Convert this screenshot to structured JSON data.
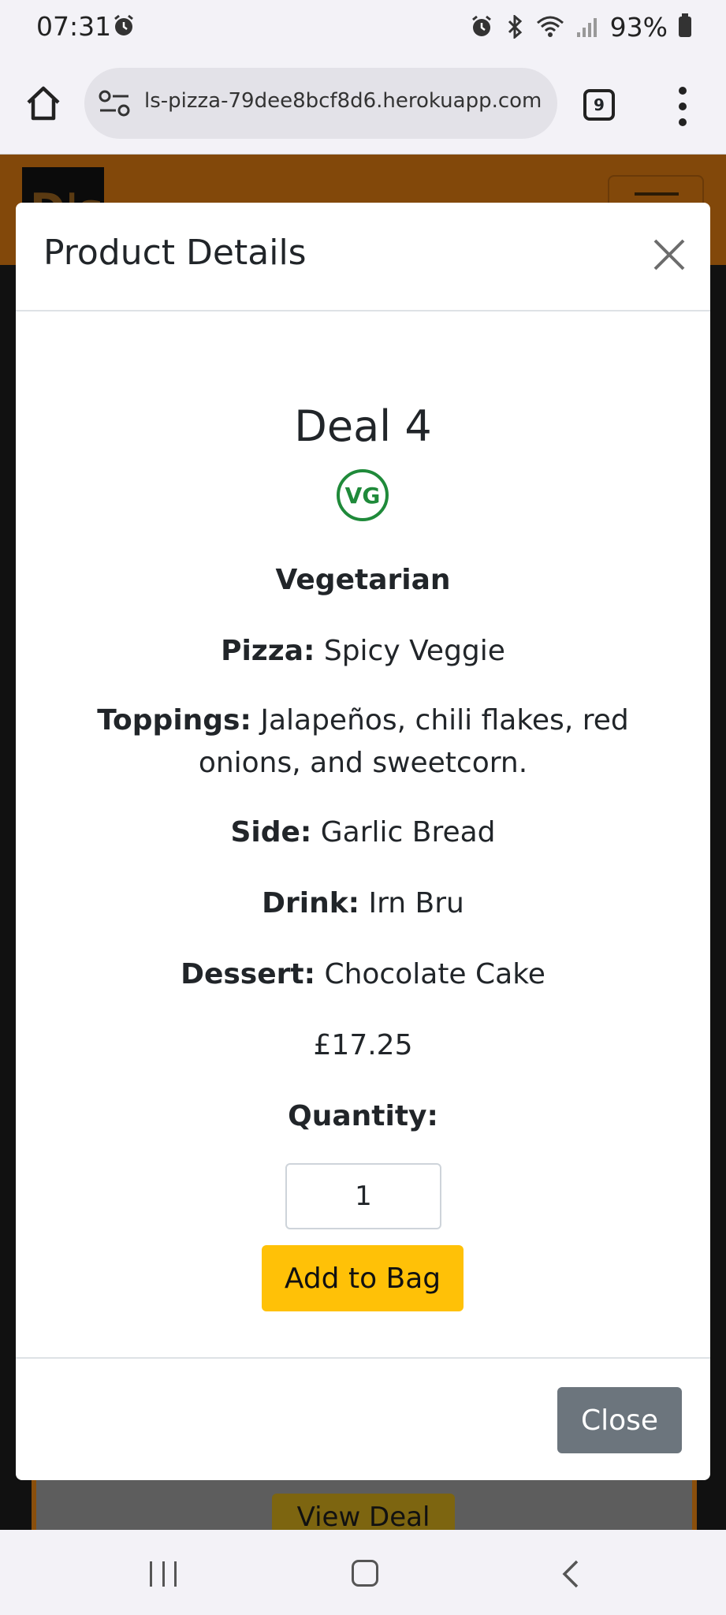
{
  "status_bar": {
    "time": "07:31",
    "battery": "93%"
  },
  "browser": {
    "url": "ls-pizza-79dee8bcf8d6.herokuapp.com",
    "tab_count": "9"
  },
  "page": {
    "logo_text": "D's",
    "view_deal_label": "View Deal",
    "header_color": "#82480a"
  },
  "modal": {
    "title": "Product Details",
    "deal_name": "Deal 4",
    "diet_badge": "VG",
    "diet_label": "Vegetarian",
    "pizza_label": "Pizza:",
    "pizza_value": "Spicy Veggie",
    "toppings_label": "Toppings:",
    "toppings_value": "Jalapeños, chili flakes, red onions, and sweetcorn.",
    "side_label": "Side:",
    "side_value": "Garlic Bread",
    "drink_label": "Drink:",
    "drink_value": "Irn Bru",
    "dessert_label": "Dessert:",
    "dessert_value": "Chocolate Cake",
    "price": "£17.25",
    "quantity_label": "Quantity:",
    "quantity_value": "1",
    "add_to_bag_label": "Add to Bag",
    "close_label": "Close"
  },
  "colors": {
    "accent_button": "#ffc107",
    "close_button": "#6c757d",
    "vegan_badge": "#1f8a3a"
  }
}
